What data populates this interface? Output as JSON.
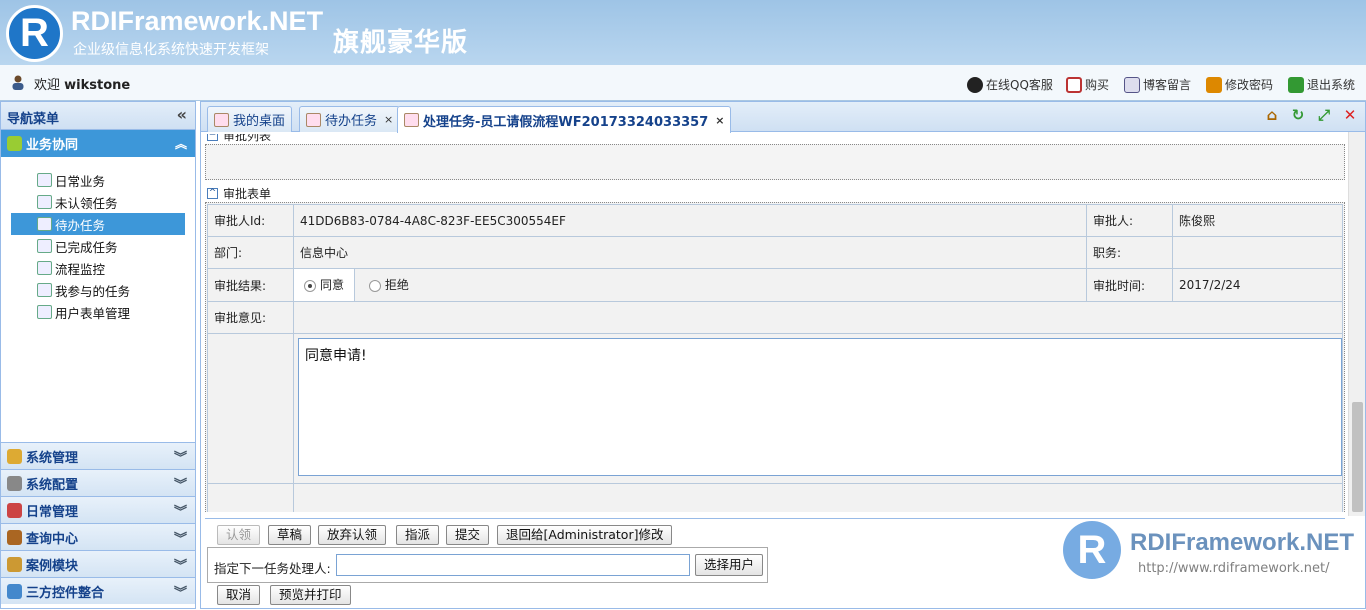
{
  "banner": {
    "logo_letter": "R",
    "name": "RDIFramework.NET",
    "subtitle": "企业级信息化系统快速开发框架",
    "edition": "旗舰豪华版"
  },
  "userbar": {
    "welcome": "欢迎",
    "username": "wikstone",
    "links": [
      "在线QQ客服",
      "购买",
      "博客留言",
      "修改密码",
      "退出系统"
    ]
  },
  "sidebar": {
    "title": "导航菜单",
    "active_group": "业务协同",
    "items": [
      {
        "label": "日常业务",
        "selected": false
      },
      {
        "label": "未认领任务",
        "selected": false
      },
      {
        "label": "待办任务",
        "selected": true
      },
      {
        "label": "已完成任务",
        "selected": false
      },
      {
        "label": "流程监控",
        "selected": false
      },
      {
        "label": "我参与的任务",
        "selected": false
      },
      {
        "label": "用户表单管理",
        "selected": false
      }
    ],
    "groups": [
      "系统管理",
      "系统配置",
      "日常管理",
      "查询中心",
      "案例模块",
      "三方控件整合"
    ]
  },
  "tabs": [
    {
      "label": "我的桌面",
      "closable": false,
      "active": false
    },
    {
      "label": "待办任务",
      "closable": true,
      "active": false
    },
    {
      "label": "处理任务-员工请假流程WF20173324033357",
      "closable": true,
      "active": true
    }
  ],
  "sections": {
    "list_title": "审批列表",
    "form_title": "审批表单"
  },
  "form": {
    "approver_id_label": "审批人Id:",
    "approver_id": "41DD6B83-0784-4A8C-823F-EE5C300554EF",
    "approver_label": "审批人:",
    "approver": "陈俊熙",
    "dept_label": "部门:",
    "dept": "信息中心",
    "duty_label": "职务:",
    "duty": "",
    "result_label": "审批结果:",
    "agree": "同意",
    "reject": "拒绝",
    "time_label": "审批时间:",
    "time": "2017/2/24",
    "opinion_label": "审批意见:",
    "opinion": "同意申请!"
  },
  "actions": {
    "claim": "认领",
    "draft": "草稿",
    "abandon": "放弃认领",
    "assign": "指派",
    "submit": "提交",
    "return": "退回给[Administrator]修改",
    "next_label": "指定下一任务处理人:",
    "next_value": "",
    "select_user": "选择用户",
    "cancel": "取消",
    "preview": "预览并打印"
  },
  "watermark": {
    "letter": "R",
    "name": "RDIFramework.NET",
    "url": "http://www.rdiframework.net/"
  },
  "colors": {
    "accent": "#3d97d9",
    "banner": "#b9d6ef",
    "border": "#99bbe8"
  }
}
